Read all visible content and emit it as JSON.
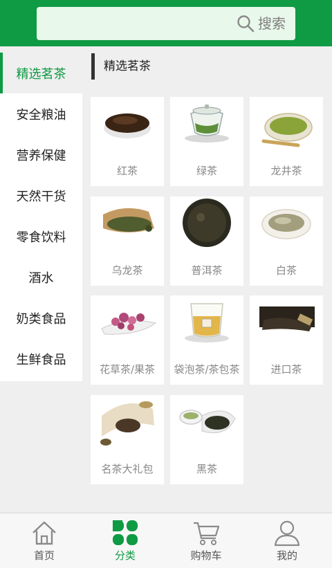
{
  "search": {
    "label": "搜索"
  },
  "sidebar": {
    "items": [
      {
        "label": "精选茗茶",
        "active": true
      },
      {
        "label": "安全粮油",
        "active": false
      },
      {
        "label": "营养保健",
        "active": false
      },
      {
        "label": "天然干货",
        "active": false
      },
      {
        "label": "零食饮料",
        "active": false
      },
      {
        "label": "酒水",
        "active": false
      },
      {
        "label": "奶类食品",
        "active": false
      },
      {
        "label": "生鲜食品",
        "active": false
      }
    ]
  },
  "section": {
    "title": "精选茗茶"
  },
  "products": [
    {
      "name": "红茶"
    },
    {
      "name": "绿茶"
    },
    {
      "name": "龙井茶"
    },
    {
      "name": "乌龙茶"
    },
    {
      "name": "普洱茶"
    },
    {
      "name": "白茶"
    },
    {
      "name": "花草茶/果茶"
    },
    {
      "name": "袋泡茶/茶包茶"
    },
    {
      "name": "进口茶"
    },
    {
      "name": "名茶大礼包"
    },
    {
      "name": "黑茶"
    }
  ],
  "tabbar": {
    "tabs": [
      {
        "label": "首页",
        "icon": "home-icon",
        "active": false
      },
      {
        "label": "分类",
        "icon": "category-icon",
        "active": true
      },
      {
        "label": "购物车",
        "icon": "cart-icon",
        "active": false
      },
      {
        "label": "我的",
        "icon": "user-icon",
        "active": false
      }
    ]
  },
  "colors": {
    "brand": "#0f9a44",
    "search_bg": "#e8f8ea",
    "page_bg": "#efefef"
  }
}
